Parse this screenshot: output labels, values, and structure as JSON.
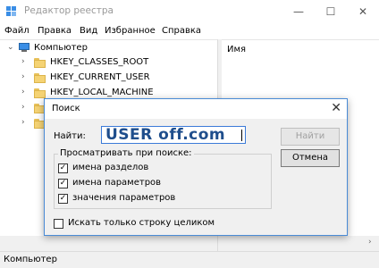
{
  "window": {
    "title": "Редактор реестра",
    "controls": {
      "minimize": "—",
      "maximize": "☐",
      "close": "✕"
    }
  },
  "menu": [
    "Файл",
    "Правка",
    "Вид",
    "Избранное",
    "Справка"
  ],
  "tree": {
    "root": "Компьютер",
    "items": [
      "HKEY_CLASSES_ROOT",
      "HKEY_CURRENT_USER",
      "HKEY_LOCAL_MACHINE"
    ]
  },
  "right_pane": {
    "column_name": "Имя"
  },
  "status": {
    "path": "Компьютер"
  },
  "dialog": {
    "title": "Поиск",
    "close": "✕",
    "find_label": "Найти:",
    "find_value": "USER off.com",
    "watermark": "USER   off.com",
    "find_next_button": "Найти далее",
    "cancel_button": "Отмена",
    "look_at_label": "Просматривать при поиске:",
    "options": [
      {
        "label": "имена разделов",
        "checked": true
      },
      {
        "label": "имена параметров",
        "checked": true
      },
      {
        "label": "значения параметров",
        "checked": true
      }
    ],
    "match_whole_label": "Искать только строку целиком",
    "match_whole_checked": false
  },
  "colors": {
    "accent": "#4a8bd6",
    "folder": "#f5d374",
    "watermark": "#1f4e8c"
  }
}
